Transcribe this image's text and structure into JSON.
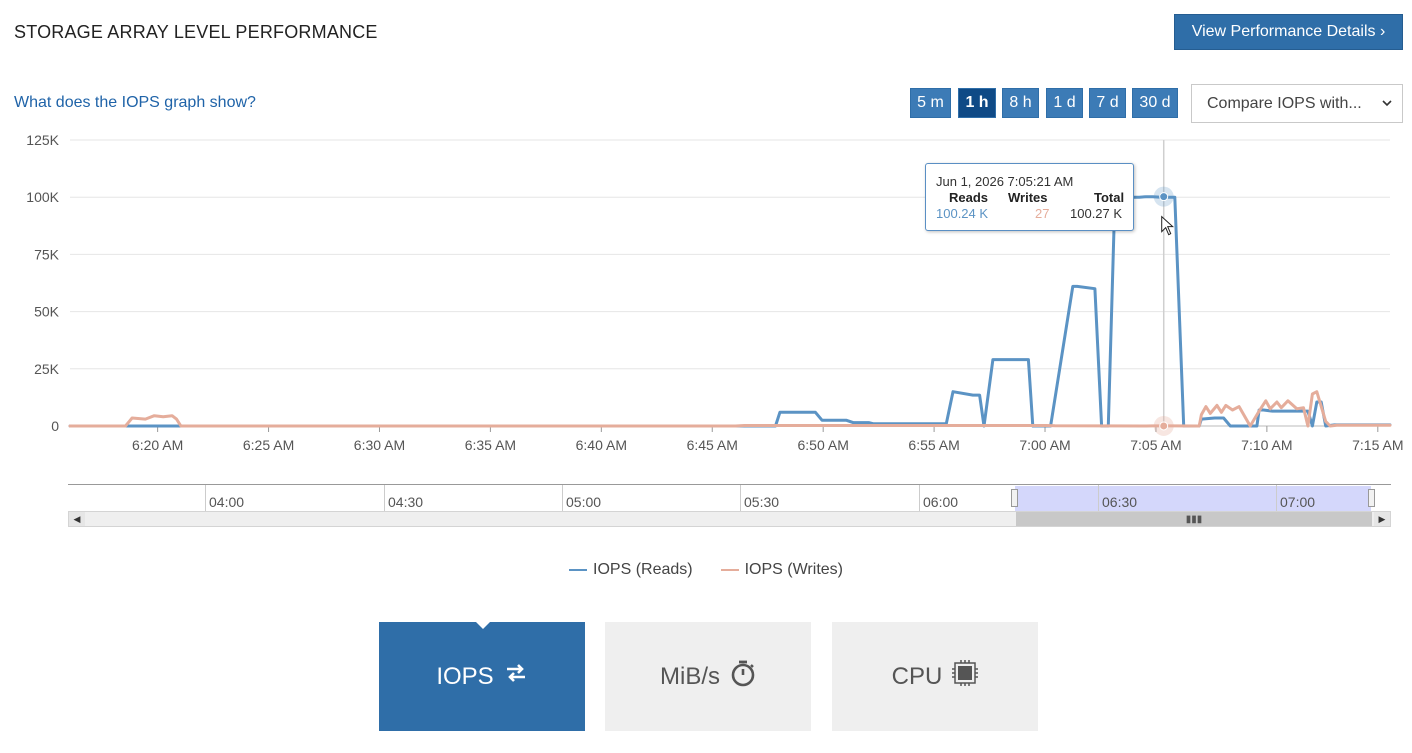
{
  "header": {
    "title": "STORAGE ARRAY LEVEL PERFORMANCE",
    "details_button": "View Performance Details ›"
  },
  "help_link": "What does the IOPS graph show?",
  "ranges": [
    {
      "label": "5 m",
      "active": false
    },
    {
      "label": "1 h",
      "active": true
    },
    {
      "label": "8 h",
      "active": false
    },
    {
      "label": "1 d",
      "active": false
    },
    {
      "label": "7 d",
      "active": false
    },
    {
      "label": "30 d",
      "active": false
    }
  ],
  "compare": {
    "label": "Compare IOPS with..."
  },
  "tooltip": {
    "timestamp": "Jun 1, 2026 7:05:21 AM",
    "reads_header": "Reads",
    "writes_header": "Writes",
    "total_header": "Total",
    "reads_value": "100.24 K",
    "writes_value": "27",
    "total_value": "100.27 K"
  },
  "navigator": {
    "labels": [
      "04:00",
      "04:30",
      "05:00",
      "05:30",
      "06:00",
      "06:30",
      "07:00"
    ],
    "selection_color": "#6a6ef0"
  },
  "legend": [
    {
      "name": "IOPS (Reads)",
      "color": "#5b93c4"
    },
    {
      "name": "IOPS (Writes)",
      "color": "#e5ad9b"
    }
  ],
  "tiles": [
    {
      "label": "IOPS",
      "icon": "swap-arrows-icon",
      "active": true
    },
    {
      "label": "MiB/s",
      "icon": "stopwatch-icon",
      "active": false
    },
    {
      "label": "CPU",
      "icon": "cpu-chip-icon",
      "active": false
    }
  ],
  "colors": {
    "accent": "#2f6ea8",
    "active_range": "#0f4a86",
    "reads": "#5b93c4",
    "writes": "#e5ad9b"
  },
  "chart_data": {
    "type": "line",
    "x_unit": "minutes",
    "xlim": [
      0,
      59.5
    ],
    "ylim": [
      0,
      125000
    ],
    "yticks": [
      {
        "value": 0,
        "label": "0"
      },
      {
        "value": 25000,
        "label": "25K"
      },
      {
        "value": 50000,
        "label": "50K"
      },
      {
        "value": 75000,
        "label": "75K"
      },
      {
        "value": 100000,
        "label": "100K"
      },
      {
        "value": 125000,
        "label": "125K"
      }
    ],
    "xticks": [
      {
        "value": 3.95,
        "label": "6:20 AM"
      },
      {
        "value": 8.95,
        "label": "6:25 AM"
      },
      {
        "value": 13.95,
        "label": "6:30 AM"
      },
      {
        "value": 18.95,
        "label": "6:35 AM"
      },
      {
        "value": 23.95,
        "label": "6:40 AM"
      },
      {
        "value": 28.95,
        "label": "6:45 AM"
      },
      {
        "value": 33.95,
        "label": "6:50 AM"
      },
      {
        "value": 38.95,
        "label": "6:55 AM"
      },
      {
        "value": 43.95,
        "label": "7:00 AM"
      },
      {
        "value": 48.95,
        "label": "7:05 AM"
      },
      {
        "value": 53.95,
        "label": "7:10 AM"
      },
      {
        "value": 58.95,
        "label": "7:15 AM"
      }
    ],
    "grid": true,
    "legend_position": "bottom-center",
    "highlight_x": 49.3,
    "series": [
      {
        "name": "IOPS (Reads)",
        "color": "#5b93c4",
        "x": [
          0,
          31.8,
          32.0,
          33.6,
          33.9,
          35.0,
          35.3,
          36.0,
          36.2,
          39.5,
          39.8,
          40.7,
          41.0,
          41.2,
          41.6,
          43.2,
          43.4,
          44.2,
          45.2,
          45.4,
          46.2,
          46.5,
          46.8,
          47.1,
          48.2,
          48.5,
          48.8,
          49.2,
          49.3,
          49.8,
          50.2,
          50.6,
          50.8,
          50.9,
          51.0,
          51.6,
          51.8,
          52.0,
          52.3,
          53.4,
          53.5,
          53.6,
          53.8,
          54.2,
          54.5,
          55.8,
          56.0,
          56.2,
          56.4,
          56.6,
          57.0,
          57.2,
          59.5
        ],
        "y": [
          0,
          0,
          6000,
          6000,
          2500,
          2500,
          1500,
          1500,
          1000,
          1000,
          15000,
          13500,
          13500,
          0,
          29000,
          29000,
          0,
          0,
          61000,
          61000,
          60000,
          0,
          0,
          100000,
          100000,
          100240,
          100240,
          100000,
          100000,
          100000,
          0,
          0,
          0,
          0,
          3000,
          3500,
          3500,
          3500,
          0,
          0,
          0,
          7000,
          7000,
          6500,
          6500,
          6500,
          0,
          10500,
          10500,
          0,
          500,
          500,
          500
        ]
      },
      {
        "name": "IOPS (Writes)",
        "color": "#e5ad9b",
        "x": [
          0,
          2.5,
          2.8,
          3.4,
          3.8,
          4.2,
          4.6,
          4.8,
          5.0,
          30,
          30.4,
          44.0,
          44.4,
          48.5,
          48.8,
          49.3,
          49.8,
          50.9,
          51.0,
          51.2,
          51.4,
          51.7,
          51.9,
          52.1,
          52.4,
          52.7,
          53.2,
          53.6,
          53.9,
          54.1,
          54.4,
          54.6,
          54.9,
          55.3,
          55.6,
          55.8,
          56.0,
          56.2,
          56.6,
          56.8,
          57.1,
          59.5
        ],
        "y": [
          0,
          0,
          3500,
          3000,
          4500,
          4000,
          4500,
          3000,
          0,
          0,
          200,
          200,
          100,
          0,
          27,
          27,
          27,
          0,
          5000,
          8500,
          5500,
          9000,
          6000,
          9000,
          7000,
          8500,
          0,
          6500,
          11000,
          7500,
          10500,
          8000,
          11000,
          7500,
          8000,
          0,
          14000,
          15000,
          2000,
          0,
          300,
          300
        ]
      }
    ]
  }
}
